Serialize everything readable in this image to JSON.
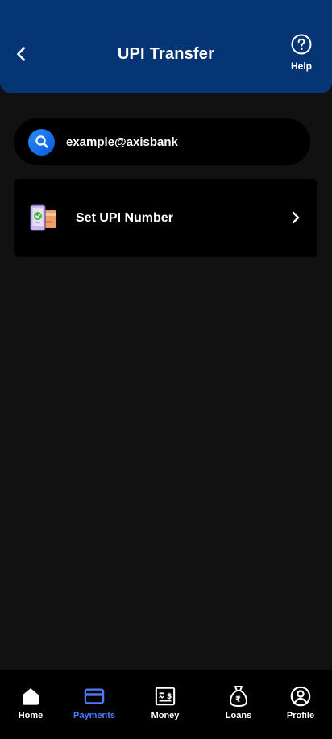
{
  "header": {
    "title": "UPI Transfer",
    "help_label": "Help"
  },
  "search": {
    "value": "example@axisbank"
  },
  "upi_card": {
    "label": "Set UPI Number"
  },
  "bottom_nav": {
    "items": [
      {
        "label": "Home",
        "icon": "home-icon"
      },
      {
        "label": "Payments",
        "icon": "card-icon",
        "active": true
      },
      {
        "label": "Money",
        "icon": "cheque-icon"
      },
      {
        "label": "Loans",
        "icon": "money-bag-icon"
      },
      {
        "label": "Profile",
        "icon": "user-circle-icon"
      }
    ]
  },
  "colors": {
    "header_bg": "#053574",
    "page_bg": "#111111",
    "accent": "#4a7dff",
    "search_accent": "#1976f0"
  }
}
